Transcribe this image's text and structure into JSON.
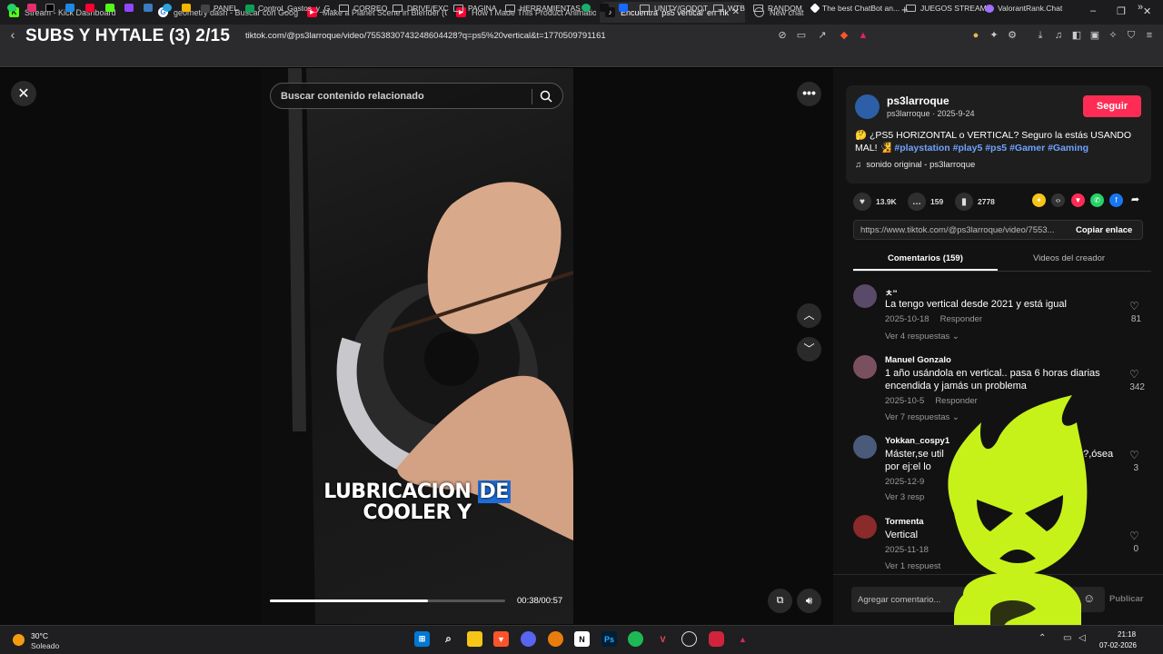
{
  "overlay": {
    "title": "SUBS Y HYTALE (3) 2/15"
  },
  "browser": {
    "tabs": [
      {
        "label": "Stream - Kick Dashboard",
        "color": "#53fc18",
        "glyph": "K"
      },
      {
        "label": "geometry dash - Buscar con Google",
        "color": "#ffffff",
        "glyph": "G"
      },
      {
        "label": "Make a Planet Scene in Blender (Und",
        "color": "#ff0033",
        "glyph": "▶"
      },
      {
        "label": "How I Made This Product Animation",
        "color": "#ff0033",
        "glyph": "▶"
      },
      {
        "label": "Encuentra 'ps5 vertical' en Tik",
        "color": "#111111",
        "glyph": "♪"
      },
      {
        "label": "New chat",
        "color": "#dddddd",
        "glyph": "◎"
      }
    ],
    "url": "tiktok.com/@ps3larroque/video/7553830743248604428?q=ps5%20vertical&t=1770509791161",
    "bookmarks": [
      "PANEL",
      "Control_Gastos_y_G...",
      "CORREO",
      "DRIVE/EXC",
      "PAGINA",
      "HERRAMIENTAS",
      "UNITY/GODOT",
      "WTB",
      "RANDOM",
      "The best ChatBot an...",
      "JUEGOS STREAM",
      "ValorantRank.Chat"
    ]
  },
  "video": {
    "search_placeholder": "Buscar contenido relacionado",
    "caption_line1_a": "LUBRICACION",
    "caption_line1_b": "DE",
    "caption_line2": "COOLER Y",
    "time": "00:38/00:57",
    "progress": 0.67
  },
  "author": {
    "name": "ps3larroque",
    "handle_date": "ps3larroque · 2025-9-24",
    "follow": "Seguir",
    "desc_text": "🤔 ¿PS5 HORIZONTAL o VERTICAL? Seguro la estás USANDO MAL! 🧏",
    "desc_tags": "#playstation #play5 #ps5 #Gamer #Gaming",
    "sound": "sonido original - ps3larroque"
  },
  "stats": {
    "likes": "13.9K",
    "comments": "159",
    "saves": "2778"
  },
  "link": {
    "url": "https://www.tiktok.com/@ps3larroque/video/7553...",
    "copy": "Copiar enlace"
  },
  "panel_tabs": {
    "comments": "Comentarios (159)",
    "creator": "Videos del creador"
  },
  "comments": [
    {
      "user": "ㅊ''",
      "text": "La tengo vertical desde 2021 y está igual",
      "date": "2025-10-18",
      "reply": "Responder",
      "replies": "Ver 4 respuestas",
      "likes": "81",
      "avatar": "#5a4a6a"
    },
    {
      "user": "Manuel Gonzalo",
      "text": "1 año usándola en vertical.. pasa 6 horas diarias encendida y jamás un problema",
      "date": "2025-10-5",
      "reply": "Responder",
      "replies": "Ver 7 respuestas",
      "likes": "342",
      "avatar": "#7a5060"
    },
    {
      "user": "Yokkan_cospy1",
      "text": "Máster,se util",
      "text2": "por ej:el lo",
      "text_right": "o?,ósea",
      "date": "2025-12-9",
      "replies": "Ver 3 resp",
      "likes": "3",
      "avatar": "#4a5a7a"
    },
    {
      "user": "Tormenta",
      "text": "Vertical",
      "date": "2025-11-18",
      "replies": "Ver 1 respuest",
      "likes": "0",
      "avatar": "#8a2a2a"
    }
  ],
  "comment_box": {
    "placeholder": "Agregar comentario...",
    "publish": "Publicar"
  },
  "taskbar": {
    "temp": "30°C",
    "weather": "Soleado",
    "time": "21:18",
    "date": "07-02-2026"
  },
  "colors": {
    "accent": "#fe2c55",
    "mascot": "#c6f21a",
    "tag": "#6fa3ff"
  }
}
